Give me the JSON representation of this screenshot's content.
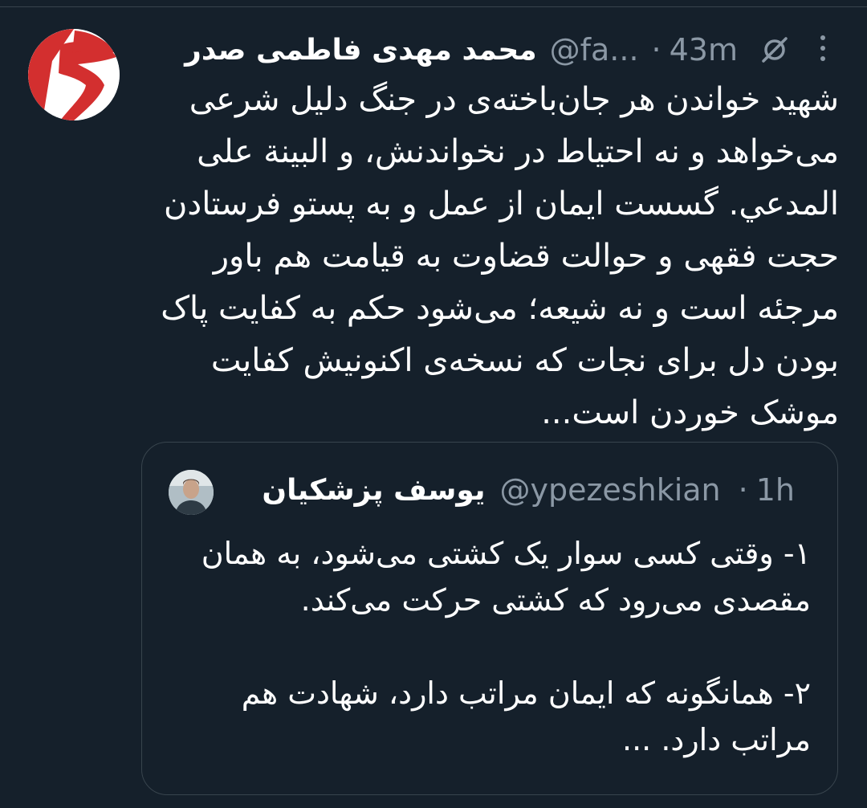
{
  "tweet": {
    "author_name": "محمد مهدی فاطمی صدر",
    "handle": "@fa...",
    "separator": "·",
    "time": "43m",
    "text": "شهید خواندن هر جان‌باخته‌ی در جنگ دلیل شرعی\nمی‌خواهد و نه احتیاط در نخواندنش، و البينة على\nالمدعي. گسست ایمان از عمل و به پستو فرستادن\nحجت فقهی و حوالت قضاوت به قیامت هم باور\nمرجئه است و نه شیعه؛ می‌شود حکم به کفایت پاک\nبودن دل برای نجات که نسخه‌ی اکنونیش کفایت\nموشک خوردن است...",
    "icons": {
      "hide": "slashed-circle-icon",
      "more": "more-vertical-icon",
      "avatar": "red-white-logo-avatar"
    }
  },
  "quote": {
    "author_name": "یوسف پزشکیان",
    "handle": "@ypezeshkian",
    "separator": "·",
    "time": "1h",
    "text": "۱- وقتی کسی سوار یک کشتی می‌شود، به همان\nمقصدی می‌رود که کشتی حرکت می‌کند.\n\n۲- همانگونه که ایمان مراتب دارد، شهادت هم\nمراتب دارد. ..."
  },
  "colors": {
    "background": "#15202b",
    "border": "#38444d",
    "secondary_text": "#8b98a5",
    "primary_text": "#ffffff",
    "avatar_red": "#d32f2f"
  }
}
